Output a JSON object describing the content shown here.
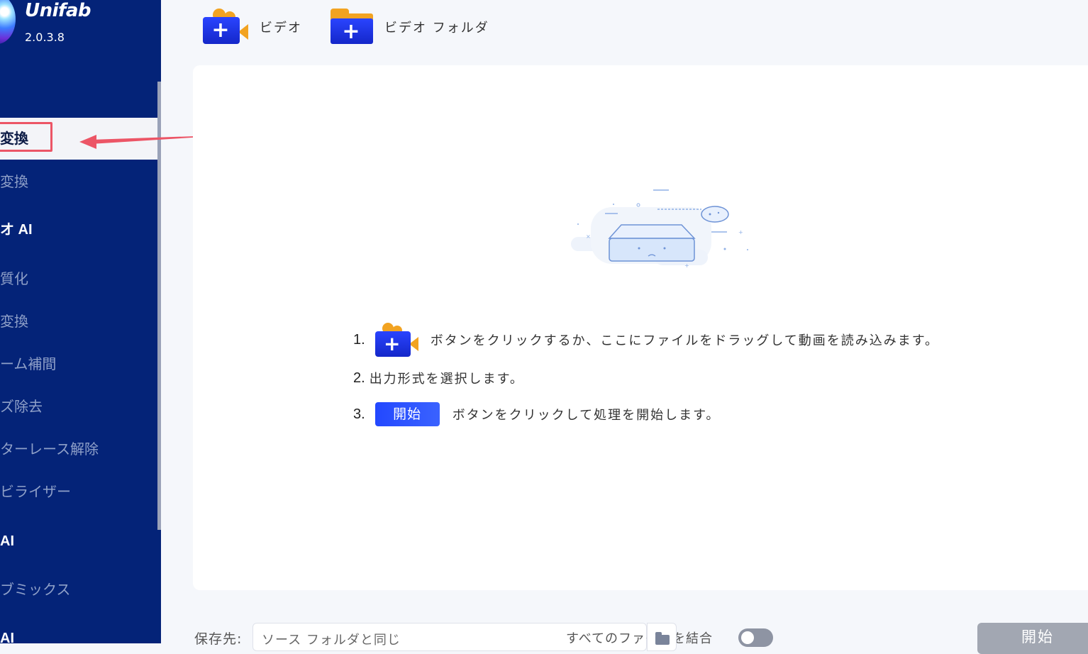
{
  "app": {
    "name": "Unifab",
    "version": "2.0.3.8"
  },
  "sidebar": {
    "items": [
      {
        "label": "変換",
        "active": true
      },
      {
        "label": "変換"
      },
      {
        "label": "オ AI",
        "section": true
      },
      {
        "label": "質化"
      },
      {
        "label": "変換"
      },
      {
        "label": "ーム補間"
      },
      {
        "label": "ズ除去"
      },
      {
        "label": "ターレース解除"
      },
      {
        "label": "ビライザー"
      },
      {
        "label": "AI",
        "section": true
      },
      {
        "label": "ブミックス"
      },
      {
        "label": "AI",
        "section": true
      }
    ]
  },
  "toolbar": {
    "add_video_label": "ビデオ",
    "add_folder_label": "ビデオ フォルダ",
    "plus_glyph": "+"
  },
  "steps": [
    {
      "num": "1.",
      "text": "ボタンをクリックするか、ここにファイルをドラッグして動画を読み込みます。"
    },
    {
      "num": "2.",
      "text": "出力形式を選択します。"
    },
    {
      "num": "3.",
      "chip": "開始",
      "text": "ボタンをクリックして処理を開始します。"
    }
  ],
  "bottom": {
    "save_label": "保存先:",
    "save_value": "ソース フォルダと同じ",
    "merge_label": "すべてのファイルを結合",
    "merge_enabled": false,
    "start_label": "開始"
  },
  "colors": {
    "sidebar_bg": "#042378",
    "accent_blue": "#2348ff",
    "icon_orange": "#f2a321",
    "annotation_red": "#ec5566"
  }
}
